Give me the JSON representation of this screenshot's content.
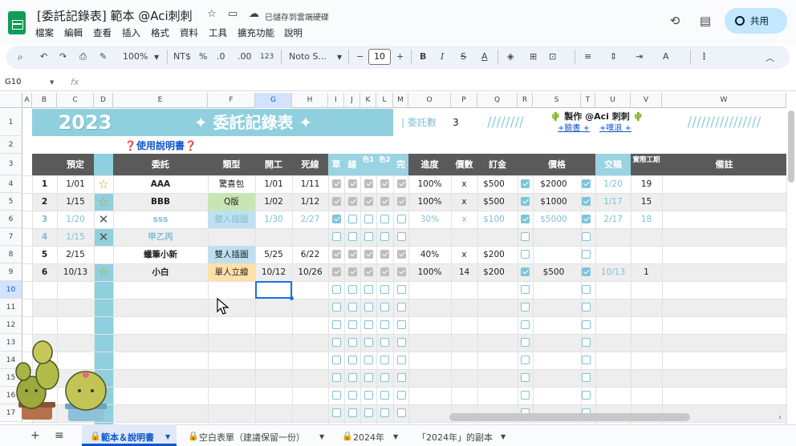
{
  "app": {
    "title": "[委託記錄表] 範本 @Aci刺刺",
    "saved": "已儲存到雲端硬碟",
    "share": "共用",
    "menus": [
      "檔案",
      "編輯",
      "查看",
      "插入",
      "格式",
      "資料",
      "工具",
      "擴充功能",
      "說明"
    ]
  },
  "toolbar": {
    "zoom": "100%",
    "currency": "NT$",
    "percent": "%",
    "dec_minus": ".0",
    "dec_plus": ".00",
    "num123": "123",
    "font": "Noto S...",
    "fontsize": "10"
  },
  "formula": {
    "cellref": "G10",
    "fx": "fx"
  },
  "columns": [
    "A",
    "B",
    "C",
    "D",
    "E",
    "F",
    "G",
    "H",
    "I",
    "J",
    "K",
    "L",
    "M",
    "O",
    "P",
    "Q",
    "R",
    "S",
    "T",
    "U",
    "V",
    "W"
  ],
  "rows": [
    "1",
    "2",
    "3",
    "4",
    "5",
    "6",
    "7",
    "8",
    "9",
    "10",
    "11",
    "12",
    "13",
    "14",
    "15",
    "16",
    "17"
  ],
  "sheet": {
    "year": "2023",
    "banner": "✦ 委託記錄表 ✦",
    "count_label": "| 委託數",
    "count": "3",
    "slashes": "////////",
    "slashes_long": "////////////////",
    "credit": "製作 @Aci 刺刺",
    "link1": "臉書",
    "link2": "噗浪",
    "guide": "使用說明書",
    "headers": [
      "預定",
      "委託",
      "類型",
      "開工",
      "死線",
      "草",
      "線",
      "色1",
      "色2",
      "完",
      "進度",
      "價數",
      "訂金",
      "價格",
      "交稿",
      "實際工期",
      "備註"
    ],
    "records": [
      {
        "no": "1",
        "date": "1/01",
        "mark": "☆",
        "name": "AAA",
        "type": "驚喜包",
        "start": "1/01",
        "dead": "1/11",
        "pct": "100%",
        "qty": "x",
        "dep": "$500",
        "price": "$2000",
        "deliv": "1/20",
        "days": "19"
      },
      {
        "no": "2",
        "date": "1/15",
        "mark": "☆",
        "name": "BBB",
        "type": "Q版",
        "start": "1/02",
        "dead": "1/12",
        "pct": "100%",
        "qty": "x",
        "dep": "$500",
        "price": "$1000",
        "deliv": "1/17",
        "days": "15"
      },
      {
        "no": "3",
        "date": "1/20",
        "mark": "✕",
        "name": "sss",
        "type": "雙人插圖",
        "start": "1/30",
        "dead": "2/27",
        "pct": "30%",
        "qty": "x",
        "dep": "$100",
        "price": "$5000",
        "deliv": "2/17",
        "days": "18"
      },
      {
        "no": "4",
        "date": "1/15",
        "mark": "✕",
        "name": "甲乙丙",
        "type": "",
        "start": "",
        "dead": "",
        "pct": "",
        "qty": "",
        "dep": "",
        "price": "",
        "deliv": "",
        "days": ""
      },
      {
        "no": "5",
        "date": "2/15",
        "mark": "",
        "name": "蠟筆小新",
        "type": "雙人插圖",
        "start": "5/25",
        "dead": "6/22",
        "pct": "40%",
        "qty": "x",
        "dep": "$200",
        "price": "",
        "deliv": "",
        "days": ""
      },
      {
        "no": "6",
        "date": "10/13",
        "mark": "☆",
        "name": "小白",
        "type": "單人立繪",
        "start": "10/12",
        "dead": "10/26",
        "pct": "100%",
        "qty": "14",
        "dep": "$200",
        "price": "$500",
        "deliv": "10/13",
        "days": "1"
      }
    ]
  },
  "tabs": [
    "範本＆說明書",
    "空白表單（建議保留一份）",
    "2024年",
    "「2024年」的副本"
  ],
  "colors": {
    "accent": "#8fcfde",
    "dark": "#5a5a5a",
    "blue_text": "#7cc0d4"
  }
}
